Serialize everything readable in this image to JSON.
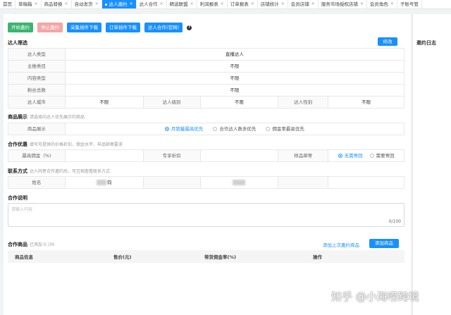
{
  "tabs": [
    {
      "label": "首页",
      "active": false,
      "closable": false
    },
    {
      "label": "草稿箱",
      "active": false,
      "closable": true
    },
    {
      "label": "商品替换",
      "active": false,
      "closable": true
    },
    {
      "label": "自动发货",
      "active": false,
      "closable": true
    },
    {
      "label": "达人邀约",
      "active": true,
      "closable": true
    },
    {
      "label": "达人合作",
      "active": false,
      "closable": true
    },
    {
      "label": "精选联盟",
      "active": false,
      "closable": true
    },
    {
      "label": "利润报表",
      "active": false,
      "closable": true
    },
    {
      "label": "订单报表",
      "active": false,
      "closable": true
    },
    {
      "label": "店铺统计",
      "active": false,
      "closable": true
    },
    {
      "label": "会员店铺",
      "active": false,
      "closable": true
    },
    {
      "label": "服务市场授权店铺",
      "active": false,
      "closable": true
    },
    {
      "label": "会员角色",
      "active": false,
      "closable": true
    },
    {
      "label": "子账号管",
      "active": false,
      "closable": false
    }
  ],
  "toolbar": {
    "start": "开始邀约",
    "stop": "停止邀约",
    "plugin1": "采集插件下载",
    "plugin2": "订单插件下载",
    "cooperate": "达人合作(官网)",
    "help": "?"
  },
  "filter": {
    "title": "达人筛选",
    "modify": "修改",
    "rows": [
      {
        "label": "达人类型",
        "value": "直播达人"
      },
      {
        "label": "主推类目",
        "value": "不限"
      },
      {
        "label": "内容类型",
        "value": "不限"
      },
      {
        "label": "粉丝总数",
        "value": "不限"
      }
    ],
    "city_label": "达人城市",
    "city_value": "不限",
    "level_label": "达人级别",
    "level_value": "不限",
    "gender_label": "达人性别",
    "gender_value": "不限"
  },
  "product_show": {
    "title": "商品展示",
    "hint": "请选择向达人优先展示的商品",
    "label": "商品展示",
    "options": [
      "月销量最高优先",
      "合作达人数多优先",
      "佣金率最高优先"
    ],
    "selected": 0
  },
  "coop": {
    "title": "合作优惠",
    "hint": "填写可提供的价格折扣、佣金水平、样品邮寄要求",
    "commission_label": "最高佣金（%)",
    "discount_label": "专享折扣",
    "sample_label": "样品邮寄",
    "sample_options": [
      "无需寄回",
      "需要寄回"
    ],
    "sample_selected": 0
  },
  "contact": {
    "title": "联系方式",
    "hint": "达人同意合作邀约后，可互相查看联系方式",
    "name_label": "姓名",
    "name_value": "钧"
  },
  "desc": {
    "title": "合作说明",
    "placeholder": "请输入内容",
    "counter": "0/100"
  },
  "products": {
    "title": "合作商品",
    "added": "已添加 0 /30",
    "add_last": "添加上次邀约商品",
    "add_btn": "添加商品",
    "columns": [
      "商品信息",
      "售价(元)",
      "带货佣金率(%)",
      "操作"
    ]
  },
  "side": {
    "title": "邀约日志"
  },
  "watermark": "知乎 @小海唠跨境"
}
